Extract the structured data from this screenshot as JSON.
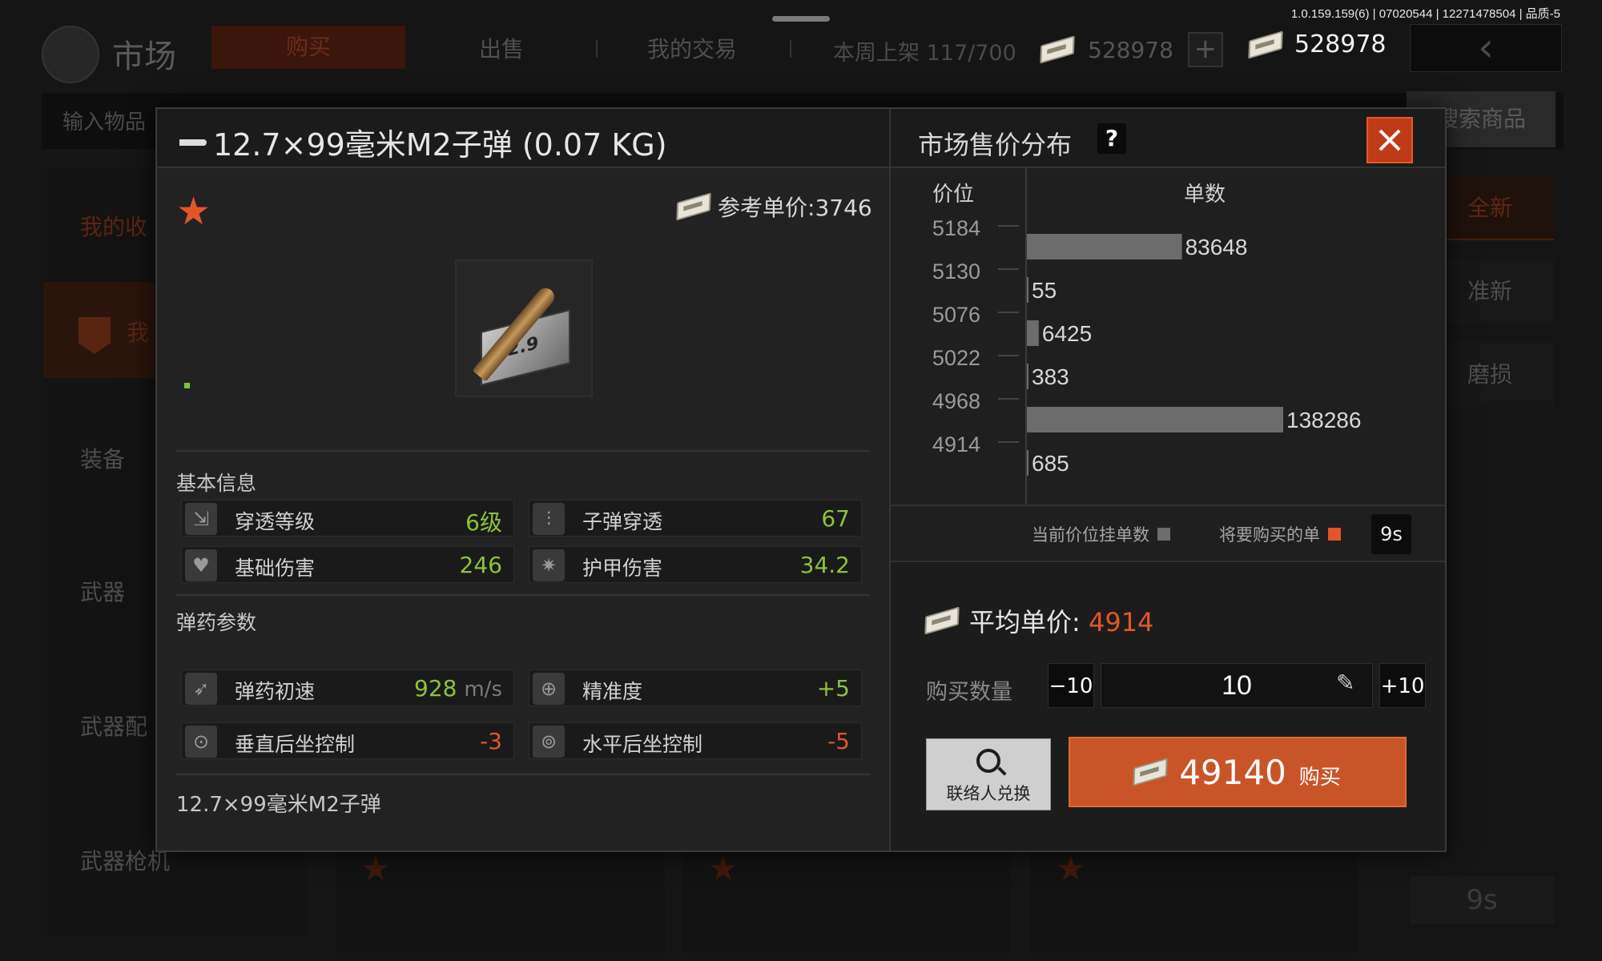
{
  "build_info": "1.0.159.159(6) | 07020544 | 12271478504 | 品质-5",
  "market": {
    "title": "市场",
    "tabs": [
      "购买",
      "出售",
      "我的交易"
    ],
    "weekly_listing_label": "本周上架",
    "weekly_listing_value": "117/700",
    "currency_1": "528978",
    "currency_2": "528978",
    "search_placeholder": "输入物品",
    "search_button": "搜索商品",
    "sidebar": [
      "我的收",
      "我",
      "装备",
      "武器",
      "武器配",
      "武器枪机"
    ],
    "filters": [
      "全新",
      "准新",
      "磨损"
    ],
    "bg_timer": "9s"
  },
  "item": {
    "title": "12.7×99毫米M2子弹 (0.07 KG)",
    "ref_price_label": "参考单价:",
    "ref_price": "3746",
    "crate_text": "12.9",
    "basic_info_label": "基本信息",
    "basic_stats": [
      {
        "name": "穿透等级",
        "value": "6级",
        "icon": "penetration-icon"
      },
      {
        "name": "子弹穿透",
        "value": "67",
        "icon": "bullet-penetration-icon"
      },
      {
        "name": "基础伤害",
        "value": "246",
        "icon": "broken-heart-icon"
      },
      {
        "name": "护甲伤害",
        "value": "34.2",
        "icon": "armor-damage-icon"
      }
    ],
    "ammo_params_label": "弹药参数",
    "ammo_stats": [
      {
        "name": "弹药初速",
        "value": "928",
        "unit": "m/s",
        "icon": "velocity-icon"
      },
      {
        "name": "精准度",
        "value": "+5",
        "icon": "crosshair-icon"
      },
      {
        "name": "垂直后坐控制",
        "value": "-3",
        "icon": "vertical-recoil-icon"
      },
      {
        "name": "水平后坐控制",
        "value": "-5",
        "icon": "horizontal-recoil-icon"
      }
    ],
    "name": "12.7×99毫米M2子弹"
  },
  "distribution": {
    "title": "市场售价分布",
    "help": "?",
    "col_price": "价位",
    "col_count": "单数",
    "legend_current": "当前价位挂单数",
    "legend_buy": "将要购买的单",
    "timer": "9s"
  },
  "chart_data": {
    "type": "bar",
    "orientation": "horizontal",
    "axis_labels": [
      "5184",
      "5130",
      "5076",
      "5022",
      "4968",
      "4914"
    ],
    "values": [
      83648,
      55,
      6425,
      383,
      138286,
      685
    ],
    "value_labels": [
      "83648",
      "55",
      "6425",
      "383",
      "138286",
      "685"
    ],
    "xlim": [
      0,
      138286
    ],
    "legend": [
      "当前价位挂单数",
      "将要购买的单"
    ],
    "colors": {
      "current": "#6c6c6c",
      "buy": "#e2562a"
    }
  },
  "purchase": {
    "avg_label": "平均单价:",
    "avg_price": "4914",
    "qty_label": "购买数量",
    "minus": "−10",
    "plus": "+10",
    "qty": "10",
    "exchange_label": "联络人兑换",
    "total": "49140",
    "buy_label": "购买"
  },
  "colors": {
    "accent": "#e2562a",
    "positive": "#8cc33b",
    "negative": "#e2562a"
  }
}
